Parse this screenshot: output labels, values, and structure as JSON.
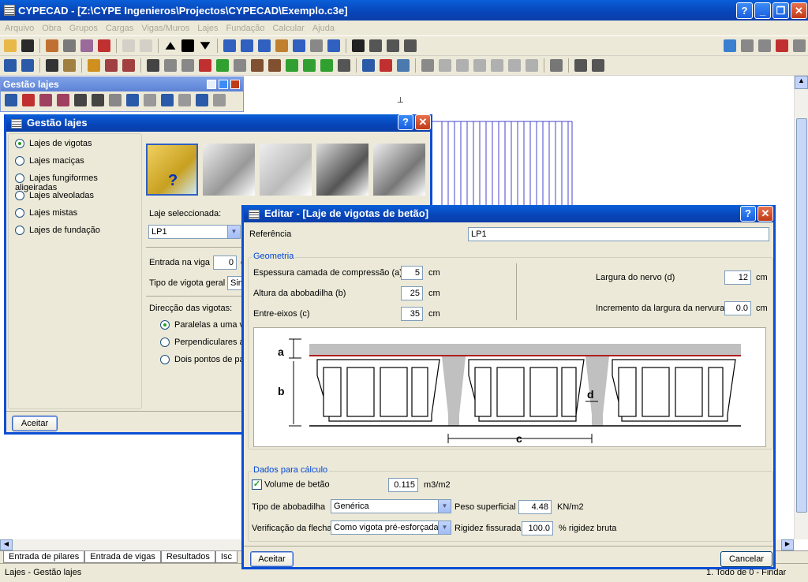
{
  "app": {
    "title": "CYPECAD - [Z:\\CYPE Ingenieros\\Projectos\\CYPECAD\\Exemplo.c3e]"
  },
  "menu": [
    "Arquivo",
    "Obra",
    "Grupos",
    "Cargas",
    "Vigas/Muros",
    "Lajes",
    "Fundação",
    "Calcular",
    "Ajuda"
  ],
  "colors": {
    "title_blue": "#0a5fd8",
    "accent_green": "#21a121",
    "canvas_line": "#4444cc"
  },
  "palette": {
    "title": "Gestão lajes"
  },
  "gestao": {
    "title": "Gestão lajes",
    "types": [
      "Lajes de vigotas",
      "Lajes maciças",
      "Lajes fungiformes aligeiradas",
      "Lajes alveoladas",
      "Lajes mistas",
      "Lajes de fundação"
    ],
    "selected_label": "Laje seleccionada:",
    "selected_value": "LP1",
    "entrada_label": "Entrada na viga",
    "entrada_value": "0",
    "entrada_unit": "c",
    "tipo_vigota_label": "Tipo de vigota geral",
    "tipo_vigota_value": "Sim",
    "direccao_label": "Direcção das vigotas:",
    "direccoes": [
      "Paralelas a uma vig",
      "Perpendiculares a u",
      "Dois pontos de pas"
    ],
    "accept": "Aceitar"
  },
  "editar": {
    "title": "Editar - [Laje de vigotas de betão]",
    "referencia_label": "Referência",
    "referencia_value": "LP1",
    "geometria_label": "Geometria",
    "esp_label": "Espessura camada de compressão (a)",
    "esp_value": "5",
    "esp_unit": "cm",
    "alt_label": "Altura da abobadilha (b)",
    "alt_value": "25",
    "alt_unit": "cm",
    "entre_label": "Entre-eixos (c)",
    "entre_value": "35",
    "entre_unit": "cm",
    "larg_label": "Largura do nervo (d)",
    "larg_value": "12",
    "larg_unit": "cm",
    "inc_label": "Incremento da largura da nervura",
    "inc_value": "0.0",
    "inc_unit": "cm",
    "diagram": {
      "a": "a",
      "b": "b",
      "c": "c",
      "d": "d"
    },
    "dados_label": "Dados para cálculo",
    "volume_label": "Volume de betão",
    "volume_value": "0.115",
    "volume_unit": "m3/m2",
    "tipo_abob_label": "Tipo de abobadilha",
    "tipo_abob_value": "Genérica",
    "peso_label": "Peso superficial",
    "peso_value": "4.48",
    "peso_unit": "KN/m2",
    "verif_label": "Verificação da flecha",
    "verif_value": "Como vigota pré-esforçada",
    "rigidez_label": "Rigidez fissurada",
    "rigidez_value": "100.0",
    "rigidez_unit": "%  rigidez bruta",
    "accept": "Aceitar",
    "cancel": "Cancelar"
  },
  "tabs": [
    "Entrada de pilares",
    "Entrada de vigas",
    "Resultados",
    "Isc"
  ],
  "status": {
    "left": "Lajes - Gestão lajes",
    "right": "1. Todo de 0 - Findar"
  }
}
